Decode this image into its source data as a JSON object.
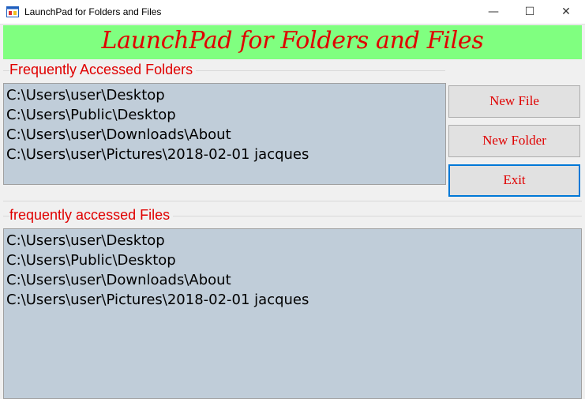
{
  "window": {
    "title": "LaunchPad for Folders and Files",
    "minimize_glyph": "—",
    "maximize_glyph": "☐",
    "close_glyph": "✕"
  },
  "banner": {
    "text": "LaunchPad for Folders and Files"
  },
  "folders": {
    "label": "Frequently Accessed Folders",
    "items": [
      "C:\\Users\\user\\Desktop",
      "C:\\Users\\Public\\Desktop",
      "C:\\Users\\user\\Downloads\\About",
      "C:\\Users\\user\\Pictures\\2018-02-01 jacques"
    ]
  },
  "files": {
    "label": "frequently accessed Files",
    "items": [
      "C:\\Users\\user\\Desktop",
      "C:\\Users\\Public\\Desktop",
      "C:\\Users\\user\\Downloads\\About",
      "C:\\Users\\user\\Pictures\\2018-02-01 jacques"
    ]
  },
  "buttons": {
    "new_file": "New File",
    "new_folder": "New Folder",
    "exit": "Exit"
  },
  "colors": {
    "banner_bg": "#80ff80",
    "accent_text": "#e00000",
    "listbox_bg": "#c0cdd9",
    "focus_border": "#0078d7"
  }
}
